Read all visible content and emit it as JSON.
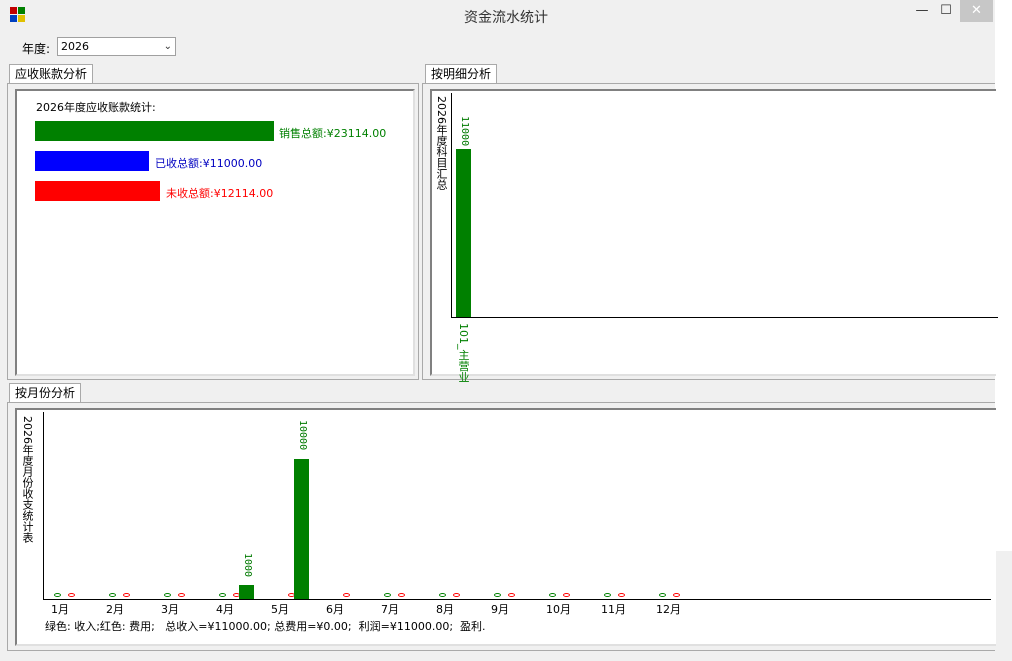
{
  "window": {
    "title": "资金流水统计",
    "minimize": "—",
    "maximize": "☐",
    "close": "✕"
  },
  "toolbar": {
    "year_label": "年度:",
    "year_value": "2026"
  },
  "tabs": {
    "receivable": "应收账款分析",
    "detail": "按明细分析",
    "monthly": "按月份分析"
  },
  "receivable": {
    "heading": "2026年度应收账款统计:",
    "sales_label": "销售总额:¥23114.00",
    "received_label": "已收总额:¥11000.00",
    "unreceived_label": "未收总额:¥12114.00",
    "colors": {
      "sales": "#008000",
      "received": "#0000ff",
      "unreceived": "#ff0000"
    }
  },
  "detail_chart": {
    "ylabel": "2026年度科目汇总",
    "bar_value": "11000",
    "bar_label": "101_主营业"
  },
  "monthly_chart": {
    "ylabel": "2026年度月份收支统计表",
    "months": [
      "1月",
      "2月",
      "3月",
      "4月",
      "5月",
      "6月",
      "7月",
      "8月",
      "9月",
      "10月",
      "11月",
      "12月"
    ],
    "zero_mark": "0",
    "label_5": "1000",
    "label_6": "10000",
    "summary": "绿色: 收入;红色: 费用;   总收入=¥11000.00; 总费用=¥0.00;  利润=¥11000.00;  盈利."
  },
  "chart_data": [
    {
      "type": "bar",
      "title": "2026年度应收账款统计:",
      "categories": [
        "销售总额",
        "已收总额",
        "未收总额"
      ],
      "values": [
        23114,
        11000,
        12114
      ]
    },
    {
      "type": "bar",
      "ylabel": "2026年度科目汇总",
      "categories": [
        "101_主营业"
      ],
      "values": [
        11000
      ]
    },
    {
      "type": "bar",
      "ylabel": "2026年度月份收支统计表",
      "categories": [
        "1月",
        "2月",
        "3月",
        "4月",
        "5月",
        "6月",
        "7月",
        "8月",
        "9月",
        "10月",
        "11月",
        "12月"
      ],
      "series": [
        {
          "name": "收入",
          "color": "#008000",
          "values": [
            0,
            0,
            0,
            0,
            1000,
            10000,
            0,
            0,
            0,
            0,
            0,
            0
          ]
        },
        {
          "name": "费用",
          "color": "#ff0000",
          "values": [
            0,
            0,
            0,
            0,
            0,
            0,
            0,
            0,
            0,
            0,
            0,
            0
          ]
        }
      ]
    }
  ]
}
